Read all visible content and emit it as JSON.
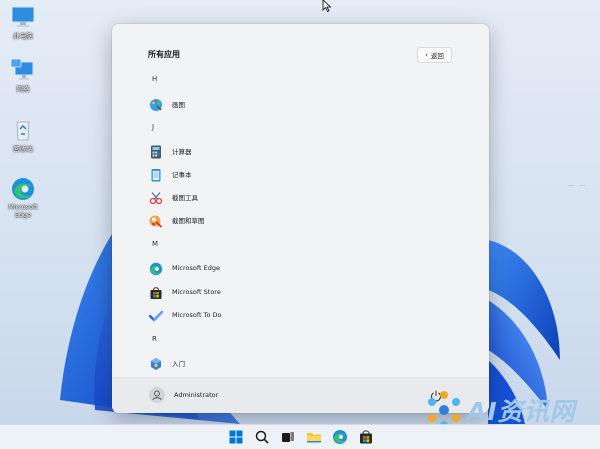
{
  "desktop": {
    "icons": [
      {
        "label": "此电脑",
        "icon": "computer-icon"
      },
      {
        "label": "网络",
        "icon": "network-icon"
      },
      {
        "label": "回收站",
        "icon": "recycle-bin-icon"
      },
      {
        "label": "Microsoft Edge",
        "icon": "edge-icon"
      }
    ]
  },
  "start_menu": {
    "title": "所有应用",
    "back_label": "返回",
    "sections": [
      {
        "letter": "H",
        "apps": [
          {
            "name": "画图",
            "icon": "paint-icon"
          }
        ]
      },
      {
        "letter": "J",
        "apps": [
          {
            "name": "计算器",
            "icon": "calculator-icon"
          },
          {
            "name": "记事本",
            "icon": "notepad-icon"
          },
          {
            "name": "截图工具",
            "icon": "snipping-tool-icon"
          },
          {
            "name": "截图和草图",
            "icon": "snip-sketch-icon"
          }
        ]
      },
      {
        "letter": "M",
        "apps": [
          {
            "name": "Microsoft Edge",
            "icon": "edge-icon"
          },
          {
            "name": "Microsoft Store",
            "icon": "store-icon"
          },
          {
            "name": "Microsoft To Do",
            "icon": "todo-icon"
          }
        ]
      },
      {
        "letter": "R",
        "apps": [
          {
            "name": "入门",
            "icon": "get-started-icon"
          }
        ]
      }
    ],
    "user": {
      "name": "Administrator"
    }
  },
  "taskbar": {
    "icons": [
      "windows-start-icon",
      "search-icon",
      "task-view-icon",
      "file-explorer-icon",
      "edge-icon",
      "store-icon"
    ]
  },
  "watermark": {
    "text": "AI资讯网"
  },
  "colors": {
    "accent": "#0078d4",
    "menu_bg": "#f2f3f5",
    "taskbar_bg": "#eef2f7"
  }
}
